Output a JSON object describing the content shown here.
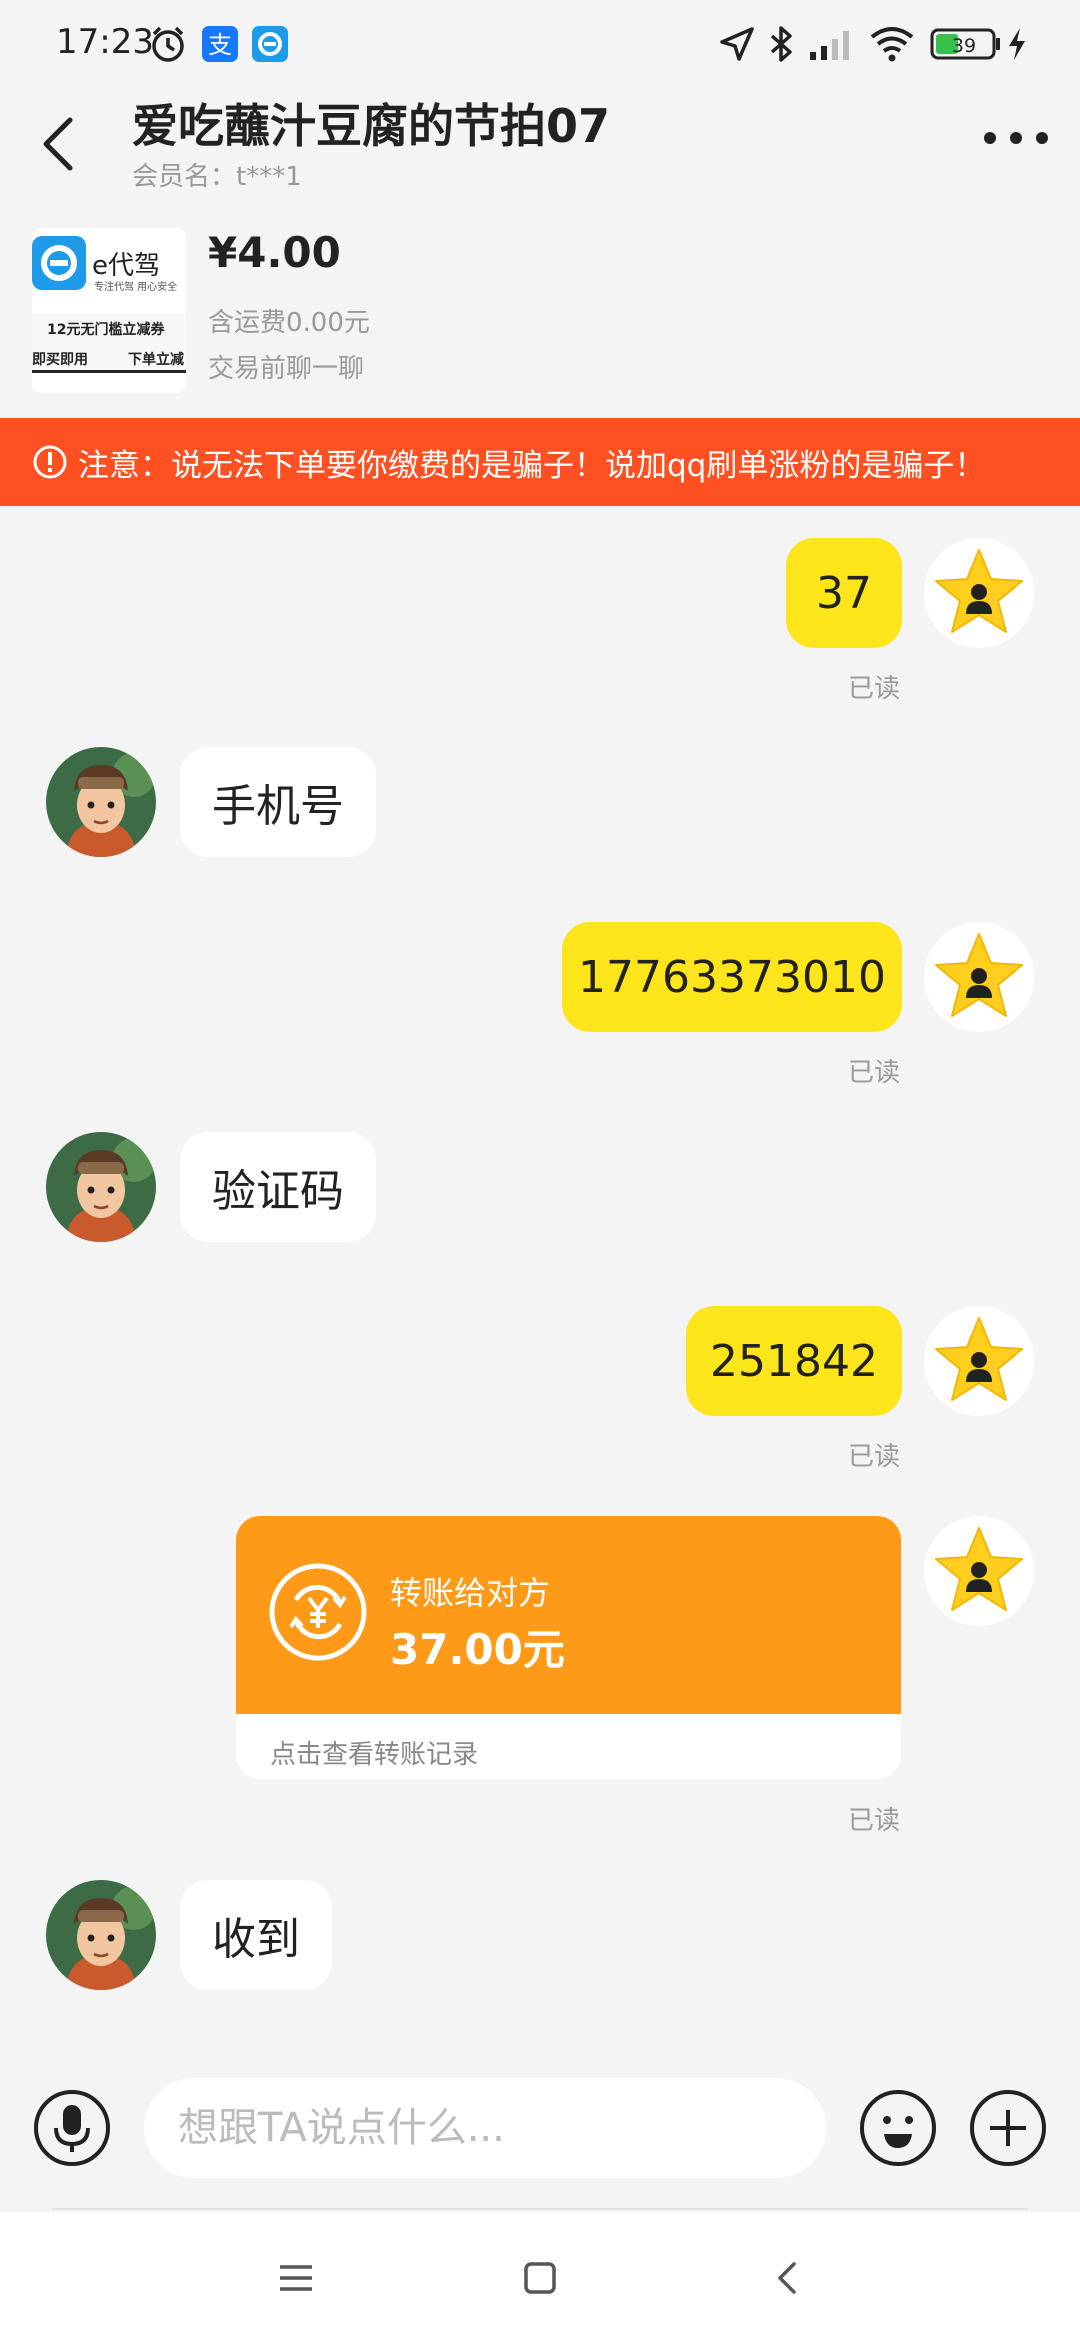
{
  "status_bar": {
    "time": "17:23",
    "battery": "39"
  },
  "header": {
    "title": "爱吃蘸汁豆腐的节拍07",
    "subtitle": "会员名：t***1"
  },
  "product": {
    "thumb_brand": "e代驾",
    "thumb_tagline": "专注代驾 用心安全",
    "thumb_coupon": "12元无门槛立减券",
    "thumb_left": "即买即用",
    "thumb_right": "下单立减",
    "price": "¥4.00",
    "shipping": "含运费0.00元",
    "hint": "交易前聊一聊"
  },
  "warning": {
    "text": "注意：说无法下单要你缴费的是骗子！说加qq刷单涨粉的是骗子！"
  },
  "messages": [
    {
      "from": "self",
      "text": "37",
      "status": "已读"
    },
    {
      "from": "other",
      "text": "手机号"
    },
    {
      "from": "self",
      "text": "17763373010",
      "status": "已读"
    },
    {
      "from": "other",
      "text": "验证码"
    },
    {
      "from": "self",
      "text": "251842",
      "status": "已读"
    },
    {
      "from": "self",
      "type": "transfer",
      "title": "转账给对方",
      "amount": "37.00元",
      "link": "点击查看转账记录",
      "status": "已读"
    },
    {
      "from": "other",
      "text": "收到"
    }
  ],
  "input": {
    "placeholder": "想跟TA说点什么..."
  },
  "colors": {
    "self_bubble": "#fde51c",
    "warning": "#ff5022",
    "transfer": "#fe9a17"
  }
}
